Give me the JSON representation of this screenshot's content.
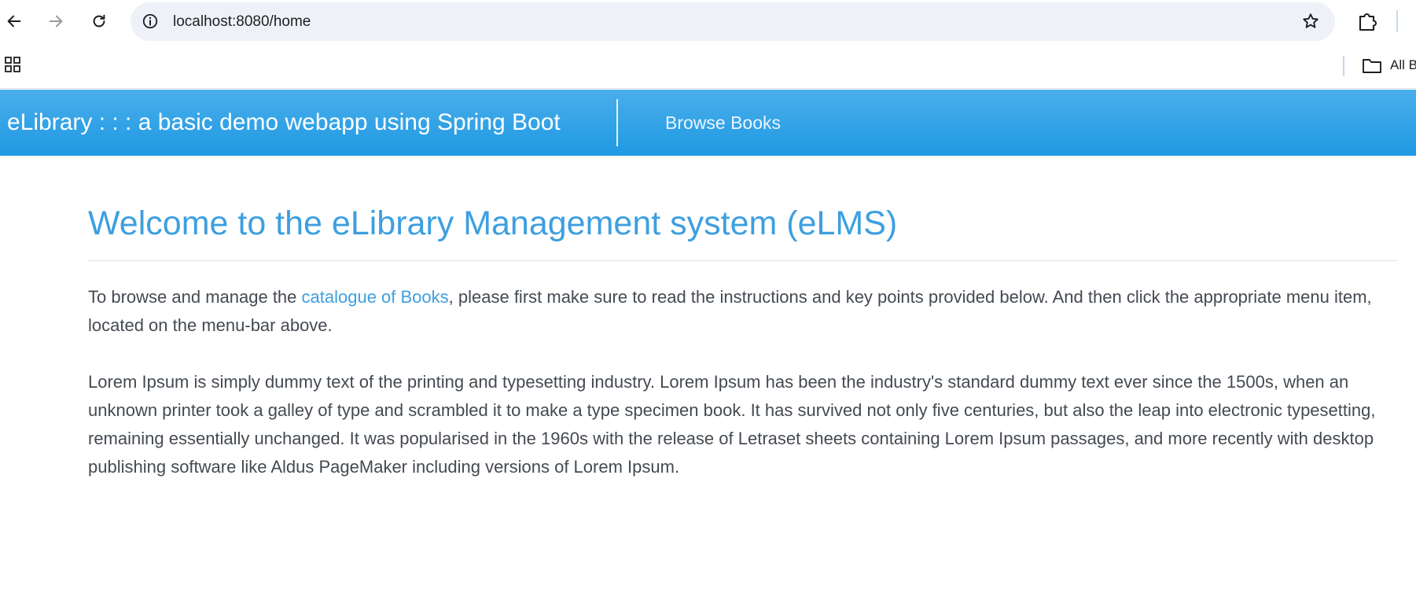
{
  "browser": {
    "url": "localhost:8080/home",
    "bookmarks_label": "All Bookmarks"
  },
  "navbar": {
    "brand": "eLibrary : : : a basic demo webapp using Spring Boot",
    "links": [
      {
        "label": "Browse Books"
      }
    ]
  },
  "main": {
    "title": "Welcome to the eLibrary Management system (eLMS)",
    "intro": {
      "before_link": "To browse and manage the ",
      "link_text": "catalogue of Books",
      "after_link": ", please first make sure to read the instructions and key points provided below. And then click the appropriate menu item, located on the menu-bar above."
    },
    "lorem": "Lorem Ipsum is simply dummy text of the printing and typesetting industry. Lorem Ipsum has been the industry's standard dummy text ever since the 1500s, when an unknown printer took a galley of type and scrambled it to make a type specimen book. It has survived not only five centuries, but also the leap into electronic typesetting, remaining essentially unchanged. It was popularised in the 1960s with the release of Letraset sheets containing Lorem Ipsum passages, and more recently with desktop publishing software like Aldus PageMaker including versions of Lorem Ipsum."
  },
  "colors": {
    "navbar_top": "#4aaeea",
    "navbar_bottom": "#1f99e3",
    "title": "#3d9fe0",
    "link": "#3d9fe0",
    "body_text": "#444a52"
  },
  "icons": {
    "back": "back-arrow-icon",
    "forward": "forward-arrow-icon",
    "reload": "reload-icon",
    "site_info": "info-icon",
    "bookmark": "star-icon",
    "extensions": "puzzle-icon",
    "apps": "apps-grid-icon",
    "folder": "folder-icon"
  }
}
